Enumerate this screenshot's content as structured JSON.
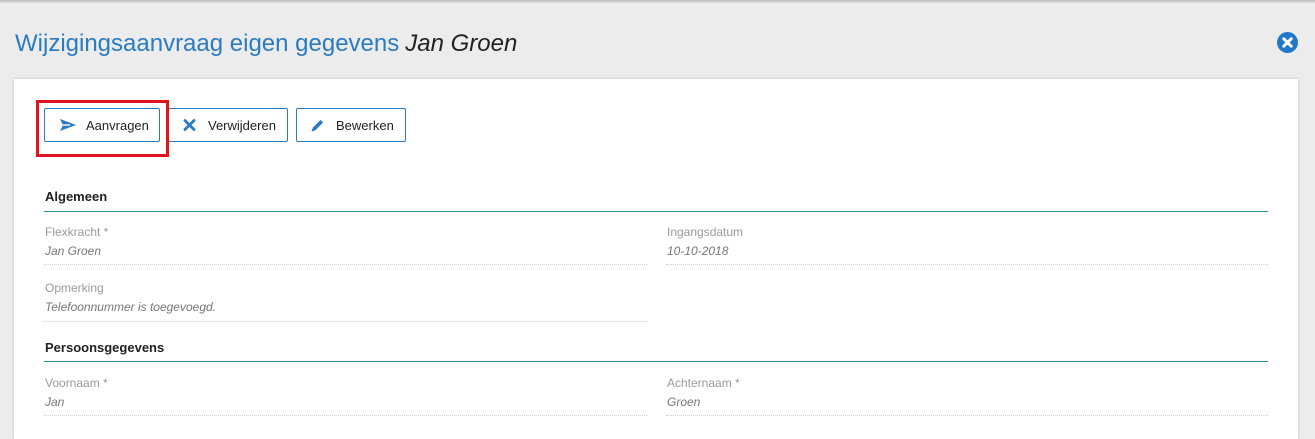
{
  "header": {
    "title": "Wijzigingsaanvraag eigen gegevens",
    "subject_name": "Jan Groen",
    "close_icon": "close-circle-icon"
  },
  "toolbar": {
    "request_label": "Aanvragen",
    "request_icon": "send-icon",
    "delete_label": "Verwijderen",
    "delete_icon": "x-icon",
    "edit_label": "Bewerken",
    "edit_icon": "pencil-icon"
  },
  "sections": {
    "general": {
      "title": "Algemeen",
      "flexworker_label": "Flexkracht *",
      "flexworker_value": "Jan Groen",
      "start_date_label": "Ingangsdatum",
      "start_date_value": "10-10-2018",
      "remark_label": "Opmerking",
      "remark_value": "Telefoonnummer is toegevoegd."
    },
    "personal": {
      "title": "Persoonsgegevens",
      "first_name_label": "Voornaam *",
      "first_name_value": "Jan",
      "last_name_label": "Achternaam *",
      "last_name_value": "Groen"
    }
  },
  "colors": {
    "accent": "#2b7bbf",
    "section_line": "#2b8f9b",
    "highlight": "#e0141e"
  }
}
